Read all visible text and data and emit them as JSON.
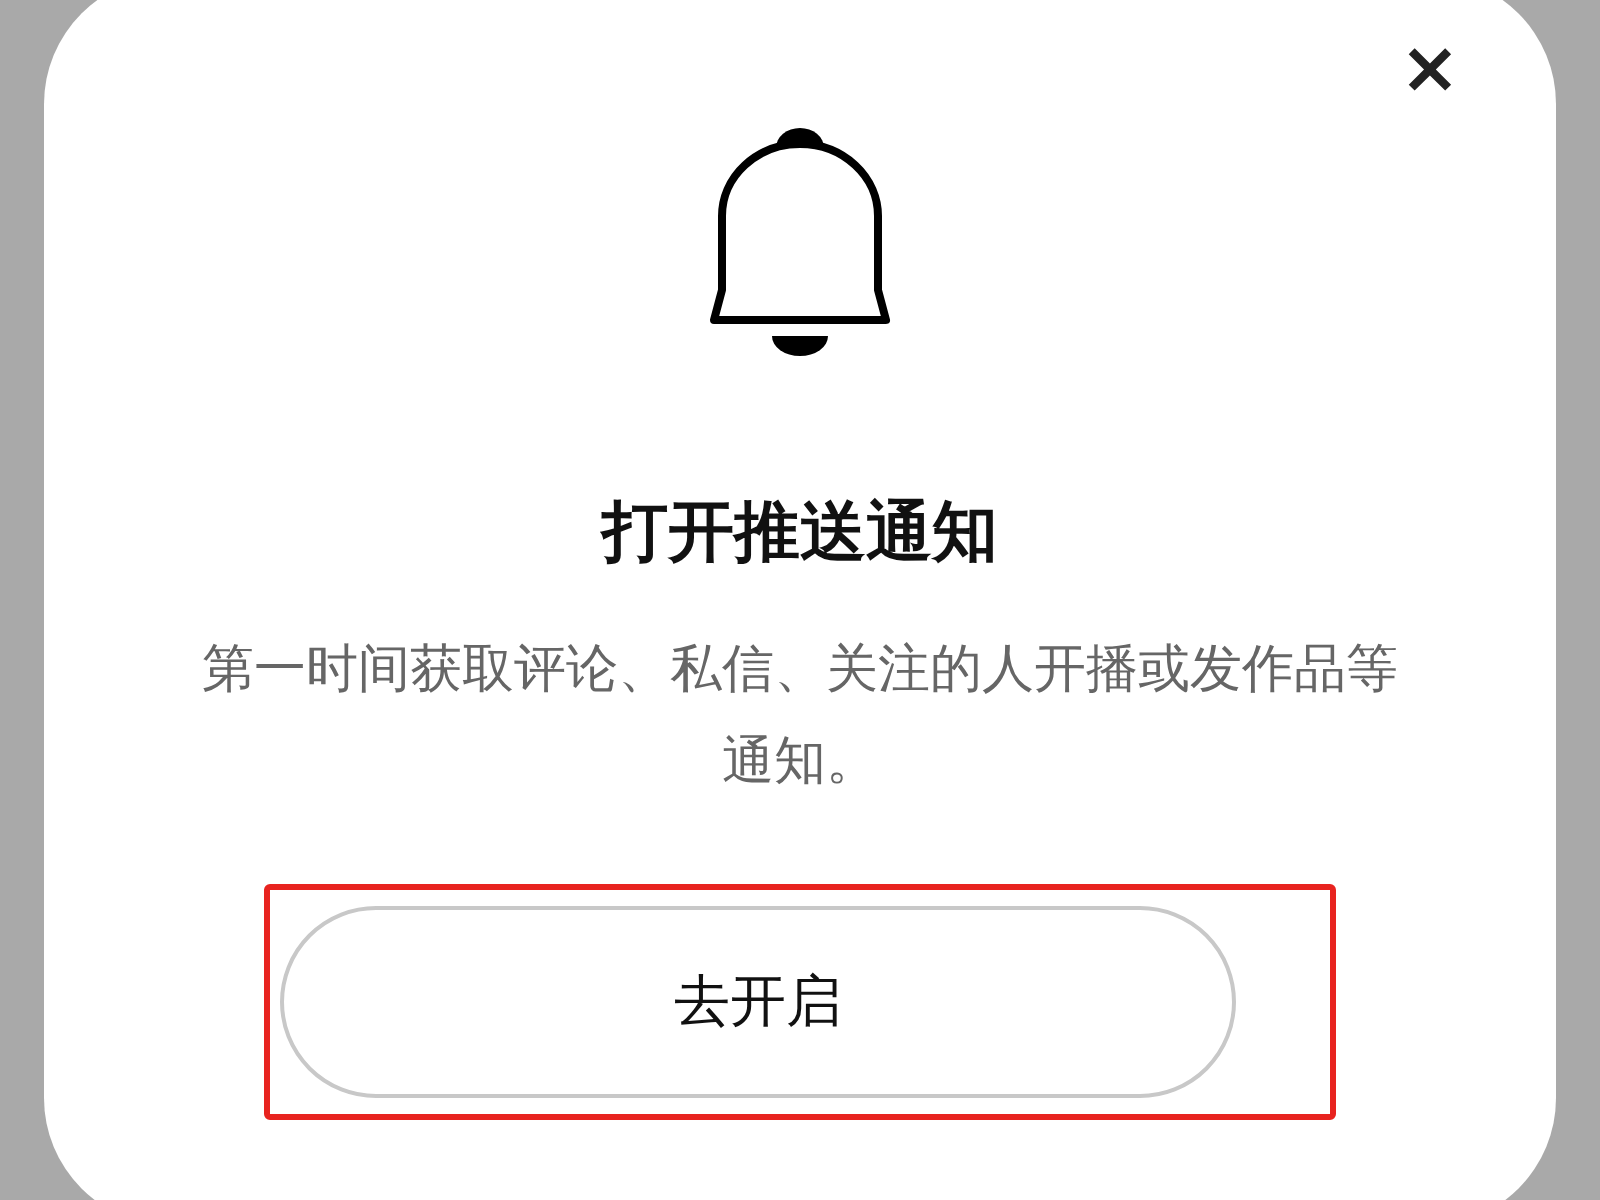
{
  "dialog": {
    "close": "×",
    "title": "打开推送通知",
    "message": "第一时间获取评论、私信、关注的人开播或发作品等通知。",
    "button": {
      "label": "去开启",
      "highlighted": true
    }
  }
}
